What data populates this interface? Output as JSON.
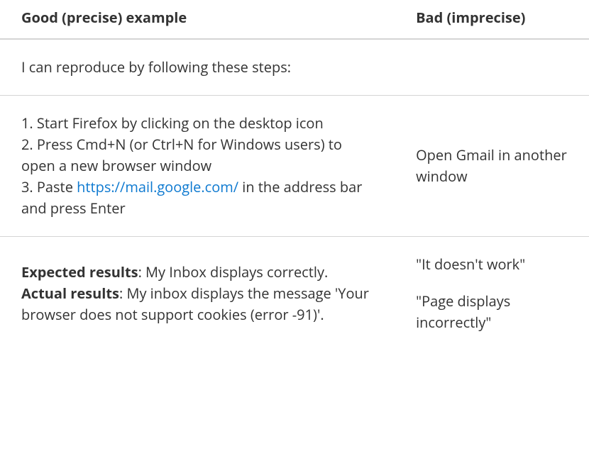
{
  "headers": {
    "good": "Good (precise) example",
    "bad": "Bad (imprecise)"
  },
  "rows": {
    "intro": {
      "good": "I can reproduce by following these steps:",
      "bad": ""
    },
    "steps": {
      "s1": "1. Start Firefox by clicking on the desktop icon",
      "s2a": "2. Press Cmd+N (or Ctrl+N for Windows users) to open a new browser window",
      "s3_prefix": "3. Paste ",
      "s3_link": "https://mail.google.com/",
      "s3_suffix": " in the address bar and press Enter",
      "bad": "Open Gmail in another window"
    },
    "results": {
      "expected_label": "Expected results",
      "expected_text": ": My Inbox displays correctly.",
      "actual_label": "Actual results",
      "actual_text": ": My inbox displays the message 'Your browser does not support cookies (error -91)'.",
      "bad1": "\"It doesn't work\"",
      "bad2": "\"Page displays incorrectly\""
    }
  }
}
